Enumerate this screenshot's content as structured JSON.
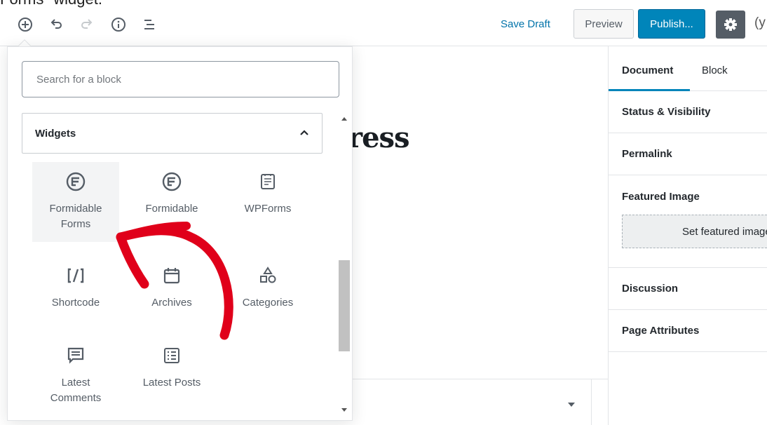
{
  "caption": "Forms\" widget.",
  "toolbar": {
    "save_draft": "Save Draft",
    "preview": "Preview",
    "publish": "Publish...",
    "yoast_fragment": "(y"
  },
  "editor": {
    "title_fragment": "ress"
  },
  "inserter": {
    "search_placeholder": "Search for a block",
    "panel_title": "Widgets",
    "blocks": [
      {
        "label": "Formidable Forms",
        "icon": "formidable-icon"
      },
      {
        "label": "Formidable",
        "icon": "formidable-icon"
      },
      {
        "label": "WPForms",
        "icon": "wpforms-icon"
      },
      {
        "label": "Shortcode",
        "icon": "shortcode-icon"
      },
      {
        "label": "Archives",
        "icon": "calendar-icon"
      },
      {
        "label": "Categories",
        "icon": "shapes-icon"
      },
      {
        "label": "Latest Comments",
        "icon": "comment-icon"
      },
      {
        "label": "Latest Posts",
        "icon": "list-icon"
      }
    ]
  },
  "sidebar": {
    "tabs": [
      "Document",
      "Block"
    ],
    "panels": [
      "Status & Visibility",
      "Permalink",
      "Featured Image",
      "Discussion",
      "Page Attributes"
    ],
    "featured_button": "Set featured image"
  },
  "colors": {
    "accent": "#0085ba",
    "link": "#0073aa",
    "annotation_arrow": "#e0001a"
  }
}
